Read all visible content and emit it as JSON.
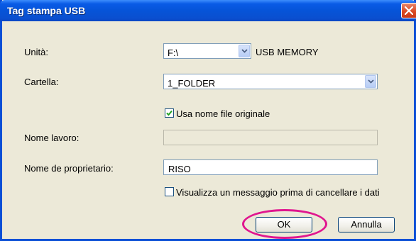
{
  "window": {
    "title": "Tag stampa USB"
  },
  "fields": {
    "unit": {
      "label": "Unità:",
      "value": "F:\\",
      "device": "USB MEMORY"
    },
    "folder": {
      "label": "Cartella:",
      "value": "1_FOLDER"
    },
    "use_original_name": {
      "label": "Usa nome file originale",
      "checked": true
    },
    "job_name": {
      "label": "Nome lavoro:",
      "value": "",
      "disabled": true
    },
    "owner_name": {
      "label": "Nome de proprietario:",
      "value": "RISO"
    },
    "confirm_delete": {
      "label": "Visualizza un messaggio prima di cancellare i dati",
      "checked": false
    }
  },
  "buttons": {
    "ok": "OK",
    "cancel": "Annulla"
  },
  "colors": {
    "title_bar": "#0654d8",
    "highlight_ring": "#e0168f",
    "dialog_bg": "#ece9d8"
  }
}
